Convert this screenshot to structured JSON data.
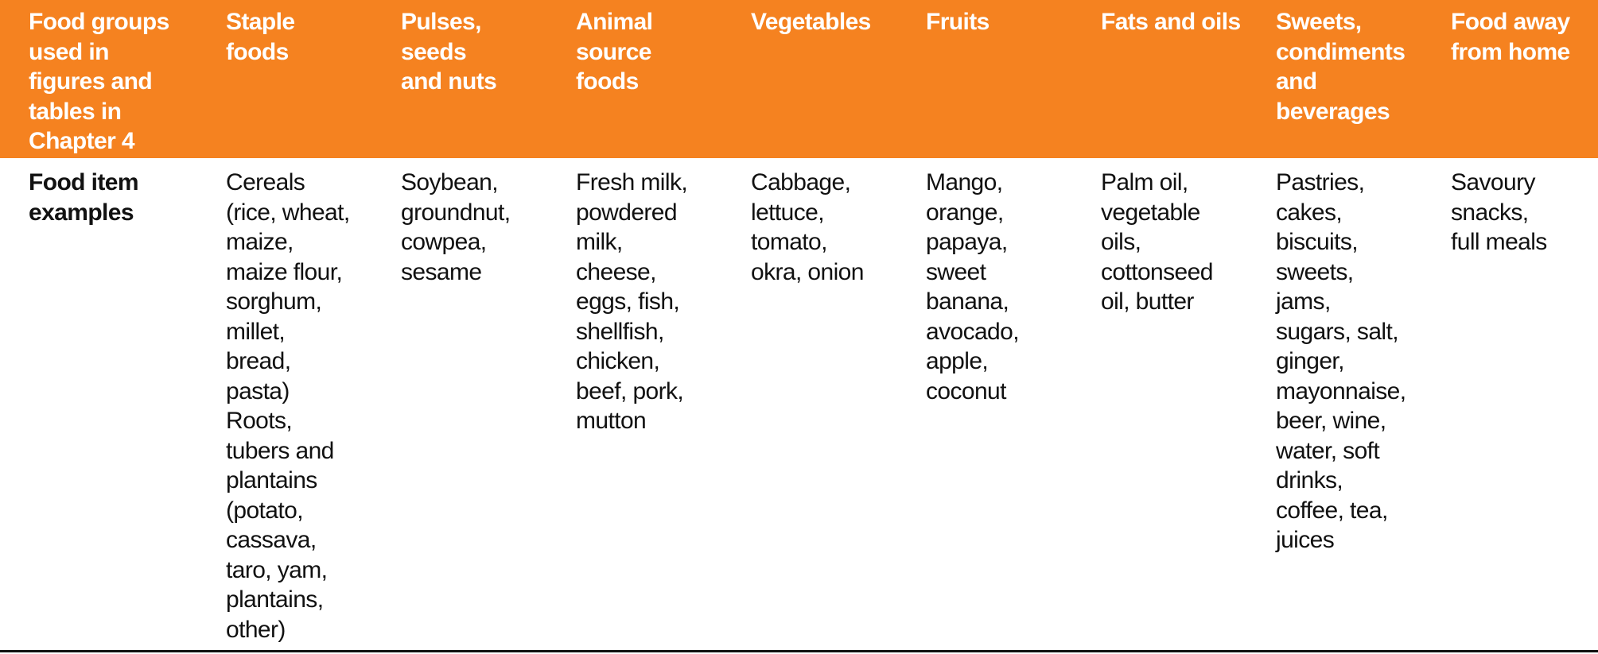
{
  "table": {
    "accent_color": "#f58220",
    "header": [
      {
        "lines": [
          "Food groups",
          "used in",
          "figures and",
          "tables in",
          "Chapter 4"
        ]
      },
      {
        "lines": [
          "Staple",
          "foods"
        ]
      },
      {
        "lines": [
          "Pulses,",
          "seeds",
          "and nuts"
        ]
      },
      {
        "lines": [
          "Animal",
          "source",
          "foods"
        ]
      },
      {
        "lines": [
          "Vegetables"
        ]
      },
      {
        "lines": [
          "Fruits"
        ]
      },
      {
        "lines": [
          "Fats and oils"
        ]
      },
      {
        "lines": [
          "Sweets,",
          "condiments",
          "and",
          "beverages"
        ]
      },
      {
        "lines": [
          "Food away",
          "from home"
        ]
      }
    ],
    "row": [
      {
        "lines": [
          "Food item",
          "examples"
        ]
      },
      {
        "lines": [
          "Cereals",
          "(rice, wheat,",
          "maize,",
          "maize flour,",
          "sorghum,",
          "millet,",
          "bread,",
          "pasta)",
          "Roots,",
          "tubers and",
          "plantains",
          "(potato,",
          "cassava,",
          "taro, yam,",
          "plantains,",
          "other)"
        ]
      },
      {
        "lines": [
          "Soybean,",
          "groundnut,",
          "cowpea,",
          "sesame"
        ]
      },
      {
        "lines": [
          "Fresh milk,",
          "powdered",
          "milk,",
          "cheese,",
          "eggs, fish,",
          "shellfish,",
          "chicken,",
          "beef, pork,",
          "mutton"
        ]
      },
      {
        "lines": [
          "Cabbage,",
          "lettuce,",
          "tomato,",
          "okra, onion"
        ]
      },
      {
        "lines": [
          "Mango,",
          "orange,",
          "papaya,",
          "sweet",
          "banana,",
          "avocado,",
          "apple,",
          "coconut"
        ]
      },
      {
        "lines": [
          "Palm oil,",
          "vegetable",
          "oils,",
          "cottonseed",
          "oil, butter"
        ]
      },
      {
        "lines": [
          "Pastries,",
          "cakes,",
          "biscuits,",
          "sweets,",
          "jams,",
          "sugars, salt,",
          "ginger,",
          "mayonnaise,",
          "beer, wine,",
          "water, soft",
          "drinks,",
          "coffee, tea,",
          "juices"
        ]
      },
      {
        "lines": [
          "Savoury",
          "snacks,",
          "full meals"
        ]
      }
    ]
  }
}
